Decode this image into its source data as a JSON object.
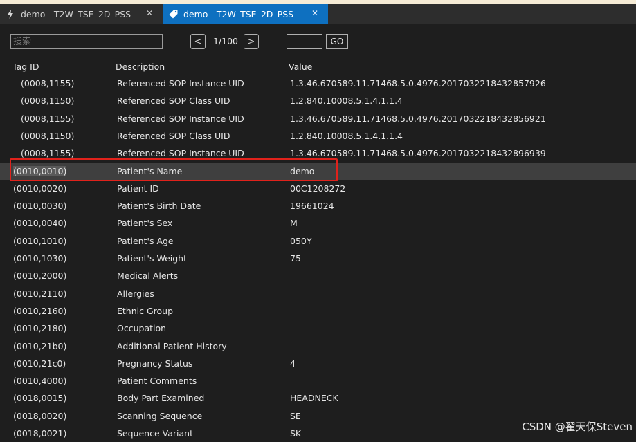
{
  "tabs": [
    {
      "icon": "lightning-icon",
      "label": "demo - T2W_TSE_2D_PSS",
      "active": false
    },
    {
      "icon": "tag-icon",
      "label": "demo - T2W_TSE_2D_PSS",
      "active": true
    }
  ],
  "toolbar": {
    "search_placeholder": "搜索",
    "prev_symbol": "<",
    "next_symbol": ">",
    "page_info": "1/100",
    "page_input_value": "",
    "go_label": "GO"
  },
  "columns": {
    "tag": "Tag ID",
    "description": "Description",
    "value": "Value"
  },
  "rows": [
    {
      "tag": "(0008,1155)",
      "desc": "Referenced SOP Instance UID",
      "value": "1.3.46.670589.11.71468.5.0.4976.2017032218432857926"
    },
    {
      "tag": "(0008,1150)",
      "desc": "Referenced SOP Class UID",
      "value": "1.2.840.10008.5.1.4.1.1.4"
    },
    {
      "tag": "(0008,1155)",
      "desc": "Referenced SOP Instance UID",
      "value": "1.3.46.670589.11.71468.5.0.4976.2017032218432856921"
    },
    {
      "tag": "(0008,1150)",
      "desc": "Referenced SOP Class UID",
      "value": "1.2.840.10008.5.1.4.1.1.4"
    },
    {
      "tag": "(0008,1155)",
      "desc": "Referenced SOP Instance UID",
      "value": "1.3.46.670589.11.71468.5.0.4976.2017032218432896939"
    },
    {
      "tag": "(0010,0010)",
      "desc": "Patient's Name",
      "value": "demo"
    },
    {
      "tag": "(0010,0020)",
      "desc": "Patient ID",
      "value": "00C1208272"
    },
    {
      "tag": "(0010,0030)",
      "desc": "Patient's Birth Date",
      "value": "19661024"
    },
    {
      "tag": "(0010,0040)",
      "desc": "Patient's Sex",
      "value": "M"
    },
    {
      "tag": "(0010,1010)",
      "desc": "Patient's Age",
      "value": "050Y"
    },
    {
      "tag": "(0010,1030)",
      "desc": "Patient's Weight",
      "value": "75"
    },
    {
      "tag": "(0010,2000)",
      "desc": "Medical Alerts",
      "value": ""
    },
    {
      "tag": "(0010,2110)",
      "desc": "Allergies",
      "value": ""
    },
    {
      "tag": "(0010,2160)",
      "desc": "Ethnic Group",
      "value": ""
    },
    {
      "tag": "(0010,2180)",
      "desc": "Occupation",
      "value": ""
    },
    {
      "tag": "(0010,21b0)",
      "desc": "Additional Patient History",
      "value": ""
    },
    {
      "tag": "(0010,21c0)",
      "desc": "Pregnancy Status",
      "value": "4"
    },
    {
      "tag": "(0010,4000)",
      "desc": "Patient Comments",
      "value": ""
    },
    {
      "tag": "(0018,0015)",
      "desc": "Body Part Examined",
      "value": "HEADNECK"
    },
    {
      "tag": "(0018,0020)",
      "desc": "Scanning Sequence",
      "value": "SE"
    },
    {
      "tag": "(0018,0021)",
      "desc": "Sequence Variant",
      "value": "SK"
    }
  ],
  "selected_row": 5,
  "watermark": "CSDN @翟天保Steven",
  "colors": {
    "accent": "#0e70c0",
    "highlight_border": "#e0221b",
    "background": "#1e1e1e"
  }
}
